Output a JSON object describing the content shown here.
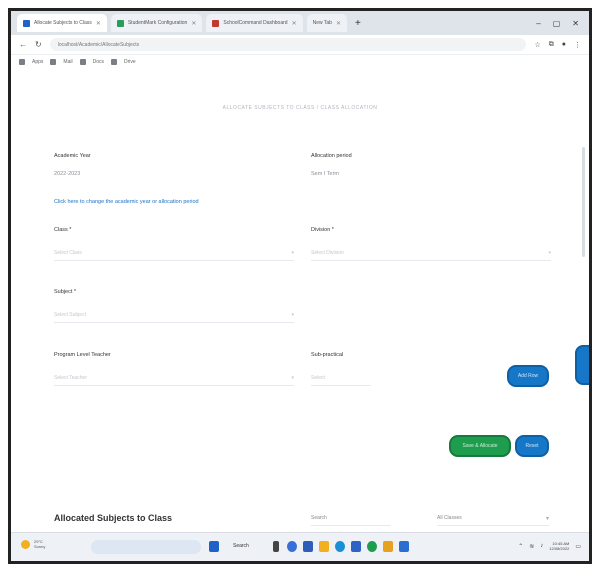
{
  "tabs": [
    {
      "label": "Allocate Subjects to Class",
      "active": true
    },
    {
      "label": "StudentMark Configuration",
      "active": false
    },
    {
      "label": "SchoolCommand Dashboard",
      "active": false
    },
    {
      "label": "New Tab",
      "active": false
    }
  ],
  "address": {
    "url": "localhost/Academic/AllocateSubjects"
  },
  "bookmarks": [
    "Apps",
    "Mail",
    "Docs",
    "Drive"
  ],
  "page": {
    "heading": "ALLOCATE SUBJECTS TO CLASS / CLASS ALLOCATION",
    "academic_year_label": "Academic Year",
    "academic_year_value": "2022-2023",
    "allocation_label": "Allocation period",
    "allocation_value": "Sem I Term",
    "link_text": "Click here to change the academic year or allocation period",
    "class_label": "Class *",
    "class_placeholder": "Select Class",
    "division_label": "Division *",
    "division_placeholder": "Select Division",
    "subject_label": "Subject *",
    "subject_placeholder": "Select Subject",
    "teacher_label": "Program Level Teacher",
    "teacher_placeholder": "Select Teacher",
    "subpractical_label": "Sub-practical",
    "subpractical_placeholder": "Select",
    "add_button": "Add Row",
    "save_button": "Save & Allocate",
    "reset_button": "Reset",
    "section_title": "Allocated Subjects to Class",
    "filter_placeholder": "Search",
    "filter_select": "All Classes"
  },
  "taskbar": {
    "weather_temp": "29°C",
    "weather_desc": "Sunny",
    "search_text": "Search",
    "time": "10:45 AM",
    "date": "12/08/2022"
  },
  "colors": {
    "primary": "#1677c9",
    "success": "#1f9d4e",
    "link": "#1a73c8"
  }
}
